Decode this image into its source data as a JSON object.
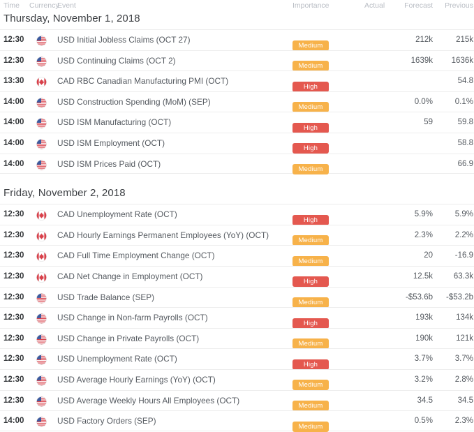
{
  "columns": {
    "time": "Time",
    "currency": "Currency",
    "event": "Event",
    "importance": "Importance",
    "actual": "Actual",
    "forecast": "Forecast",
    "previous": "Previous"
  },
  "colors": {
    "medium": "#f7b24a",
    "high": "#e4584f",
    "row_border": "#ededed",
    "header_text": "#b9bdc4",
    "event_text": "#555a60",
    "day_text": "#3d4044"
  },
  "days": [
    {
      "title": "Thursday, November 1, 2018",
      "rows": [
        {
          "time": "12:30",
          "flag": "us-flag-icon",
          "event": "USD Initial Jobless Claims (OCT 27)",
          "importance": "Medium",
          "importance_level": "medium",
          "actual": "",
          "forecast": "212k",
          "previous": "215k"
        },
        {
          "time": "12:30",
          "flag": "us-flag-icon",
          "event": "USD Continuing Claims (OCT 2)",
          "importance": "Medium",
          "importance_level": "medium",
          "actual": "",
          "forecast": "1639k",
          "previous": "1636k"
        },
        {
          "time": "13:30",
          "flag": "ca-flag-icon",
          "event": "CAD RBC Canadian Manufacturing PMI (OCT)",
          "importance": "High",
          "importance_level": "high",
          "actual": "",
          "forecast": "",
          "previous": "54.8"
        },
        {
          "time": "14:00",
          "flag": "us-flag-icon",
          "event": "USD Construction Spending (MoM) (SEP)",
          "importance": "Medium",
          "importance_level": "medium",
          "actual": "",
          "forecast": "0.0%",
          "previous": "0.1%"
        },
        {
          "time": "14:00",
          "flag": "us-flag-icon",
          "event": "USD ISM Manufacturing (OCT)",
          "importance": "High",
          "importance_level": "high",
          "actual": "",
          "forecast": "59",
          "previous": "59.8"
        },
        {
          "time": "14:00",
          "flag": "us-flag-icon",
          "event": "USD ISM Employment (OCT)",
          "importance": "High",
          "importance_level": "high",
          "actual": "",
          "forecast": "",
          "previous": "58.8"
        },
        {
          "time": "14:00",
          "flag": "us-flag-icon",
          "event": "USD ISM Prices Paid (OCT)",
          "importance": "Medium",
          "importance_level": "medium",
          "actual": "",
          "forecast": "",
          "previous": "66.9"
        }
      ]
    },
    {
      "title": "Friday, November 2, 2018",
      "rows": [
        {
          "time": "12:30",
          "flag": "ca-flag-icon",
          "event": "CAD Unemployment Rate (OCT)",
          "importance": "High",
          "importance_level": "high",
          "actual": "",
          "forecast": "5.9%",
          "previous": "5.9%"
        },
        {
          "time": "12:30",
          "flag": "ca-flag-icon",
          "event": "CAD Hourly Earnings Permanent Employees (YoY) (OCT)",
          "importance": "Medium",
          "importance_level": "medium",
          "actual": "",
          "forecast": "2.3%",
          "previous": "2.2%"
        },
        {
          "time": "12:30",
          "flag": "ca-flag-icon",
          "event": "CAD Full Time Employment Change (OCT)",
          "importance": "Medium",
          "importance_level": "medium",
          "actual": "",
          "forecast": "20",
          "previous": "-16.9"
        },
        {
          "time": "12:30",
          "flag": "ca-flag-icon",
          "event": "CAD Net Change in Employment (OCT)",
          "importance": "High",
          "importance_level": "high",
          "actual": "",
          "forecast": "12.5k",
          "previous": "63.3k"
        },
        {
          "time": "12:30",
          "flag": "us-flag-icon",
          "event": "USD Trade Balance (SEP)",
          "importance": "Medium",
          "importance_level": "medium",
          "actual": "",
          "forecast": "-$53.6b",
          "previous": "-$53.2b"
        },
        {
          "time": "12:30",
          "flag": "us-flag-icon",
          "event": "USD Change in Non-farm Payrolls (OCT)",
          "importance": "High",
          "importance_level": "high",
          "actual": "",
          "forecast": "193k",
          "previous": "134k"
        },
        {
          "time": "12:30",
          "flag": "us-flag-icon",
          "event": "USD Change in Private Payrolls (OCT)",
          "importance": "Medium",
          "importance_level": "medium",
          "actual": "",
          "forecast": "190k",
          "previous": "121k"
        },
        {
          "time": "12:30",
          "flag": "us-flag-icon",
          "event": "USD Unemployment Rate (OCT)",
          "importance": "High",
          "importance_level": "high",
          "actual": "",
          "forecast": "3.7%",
          "previous": "3.7%"
        },
        {
          "time": "12:30",
          "flag": "us-flag-icon",
          "event": "USD Average Hourly Earnings (YoY) (OCT)",
          "importance": "Medium",
          "importance_level": "medium",
          "actual": "",
          "forecast": "3.2%",
          "previous": "2.8%"
        },
        {
          "time": "12:30",
          "flag": "us-flag-icon",
          "event": "USD Average Weekly Hours All Employees (OCT)",
          "importance": "Medium",
          "importance_level": "medium",
          "actual": "",
          "forecast": "34.5",
          "previous": "34.5"
        },
        {
          "time": "14:00",
          "flag": "us-flag-icon",
          "event": "USD Factory Orders (SEP)",
          "importance": "Medium",
          "importance_level": "medium",
          "actual": "",
          "forecast": "0.5%",
          "previous": "2.3%"
        }
      ]
    }
  ]
}
